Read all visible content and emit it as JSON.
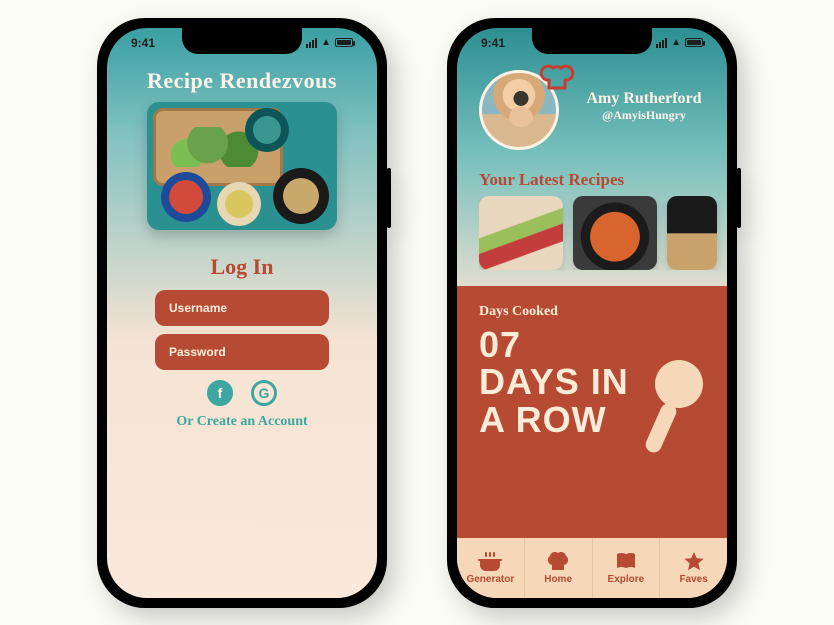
{
  "status": {
    "time": "9:41"
  },
  "login": {
    "app_title": "Recipe Rendezvous",
    "heading": "Log In",
    "username_placeholder": "Username",
    "password_placeholder": "Password",
    "create_account": "Or Create an Account"
  },
  "home": {
    "user_name": "Amy Rutherford",
    "user_handle": "@AmyisHungry",
    "latest_heading": "Your Latest Recipes",
    "streak": {
      "label": "Days Cooked",
      "count": "07",
      "line1": "DAYS IN",
      "line2": "A ROW"
    },
    "tabs": {
      "generator": "Generator",
      "home": "Home",
      "explore": "Explore",
      "faves": "Faves"
    }
  },
  "colors": {
    "rust": "#b64a32",
    "teal": "#3ea6a0",
    "cream": "#fdf0e0",
    "peach": "#f6d7b8"
  }
}
